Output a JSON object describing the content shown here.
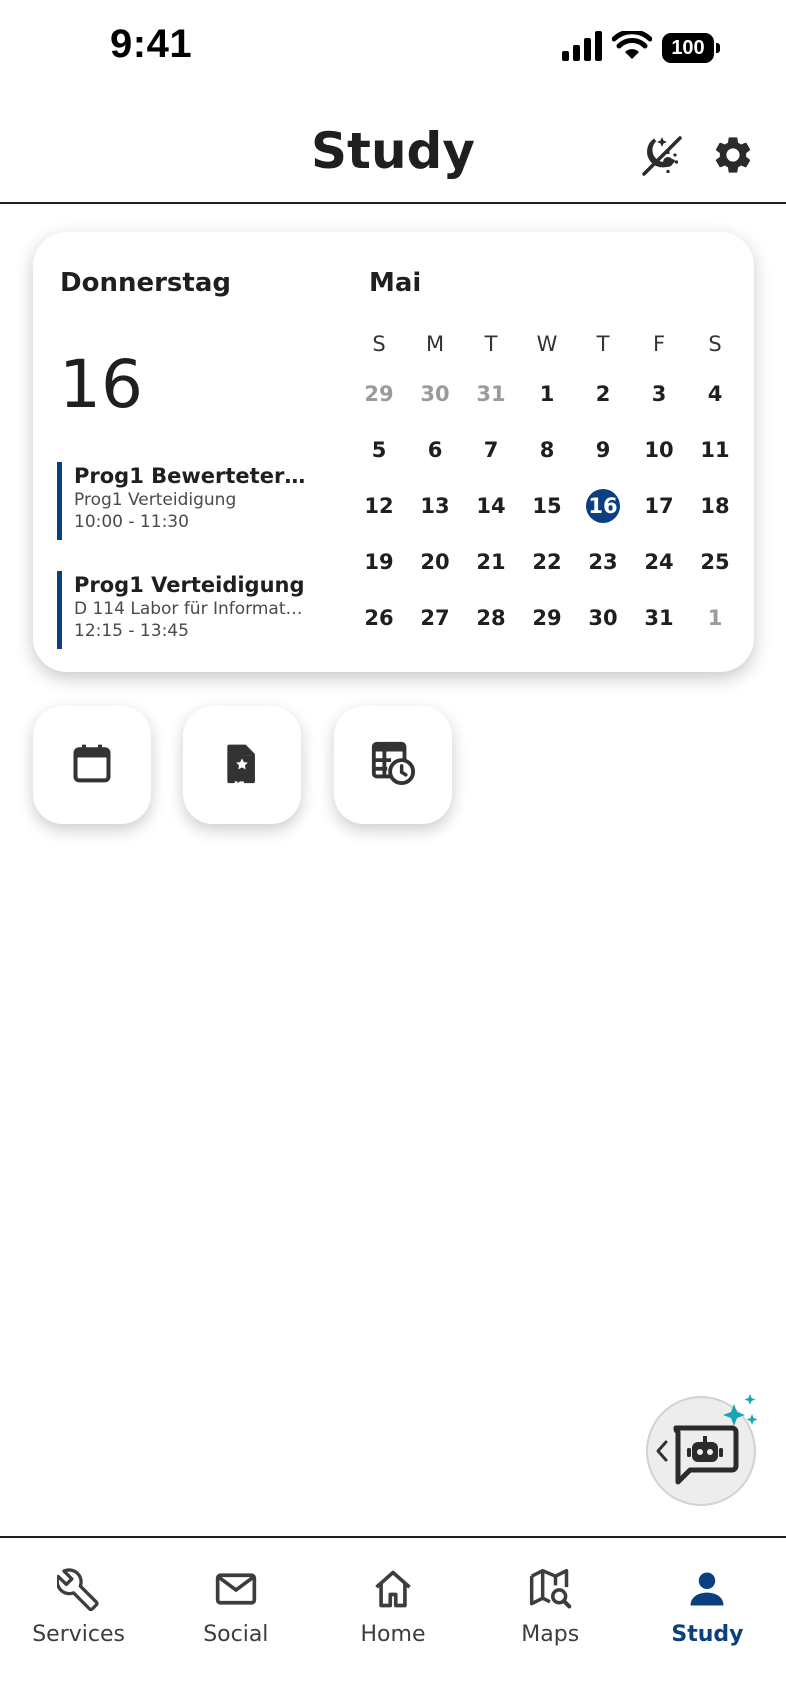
{
  "status_bar": {
    "time": "9:41",
    "battery": "100",
    "icons": [
      "cellular-signal-icon",
      "wifi-icon",
      "battery-icon"
    ]
  },
  "header": {
    "title": "Study",
    "icons": [
      "theme-toggle-icon",
      "gear-icon"
    ]
  },
  "calendar_card": {
    "weekday": "Donnerstag",
    "day_number": "16",
    "events": [
      {
        "title": "Prog1 Bewerteter …",
        "subtitle": "Prog1 Verteidigung",
        "time": "10:00 - 11:30"
      },
      {
        "title": "Prog1 Verteidigung",
        "subtitle": "D 114 Labor für Informat…",
        "time": "12:15 - 13:45"
      }
    ],
    "month": "Mai",
    "weekday_headers": [
      "S",
      "M",
      "T",
      "W",
      "T",
      "F",
      "S"
    ],
    "weeks": [
      [
        {
          "d": "29",
          "muted": true
        },
        {
          "d": "30",
          "muted": true
        },
        {
          "d": "31",
          "muted": true
        },
        {
          "d": "1"
        },
        {
          "d": "2"
        },
        {
          "d": "3"
        },
        {
          "d": "4"
        }
      ],
      [
        {
          "d": "5"
        },
        {
          "d": "6"
        },
        {
          "d": "7"
        },
        {
          "d": "8"
        },
        {
          "d": "9"
        },
        {
          "d": "10"
        },
        {
          "d": "11"
        }
      ],
      [
        {
          "d": "12"
        },
        {
          "d": "13"
        },
        {
          "d": "14"
        },
        {
          "d": "15"
        },
        {
          "d": "16",
          "today": true
        },
        {
          "d": "17"
        },
        {
          "d": "18"
        }
      ],
      [
        {
          "d": "19"
        },
        {
          "d": "20"
        },
        {
          "d": "21"
        },
        {
          "d": "22"
        },
        {
          "d": "23"
        },
        {
          "d": "24"
        },
        {
          "d": "25"
        }
      ],
      [
        {
          "d": "26"
        },
        {
          "d": "27"
        },
        {
          "d": "28"
        },
        {
          "d": "29"
        },
        {
          "d": "30"
        },
        {
          "d": "31"
        },
        {
          "d": "1",
          "muted": true
        }
      ]
    ]
  },
  "quick_actions": [
    "calendar-icon",
    "certificate-document-icon",
    "schedule-table-icon"
  ],
  "chatbot_fab": {
    "icon": "chatbot-robot-icon"
  },
  "bottom_nav": {
    "items": [
      {
        "label": "Services",
        "icon": "wrench-icon",
        "active": false
      },
      {
        "label": "Social",
        "icon": "mail-icon",
        "active": false
      },
      {
        "label": "Home",
        "icon": "home-icon",
        "active": false
      },
      {
        "label": "Maps",
        "icon": "map-search-icon",
        "active": false
      },
      {
        "label": "Study",
        "icon": "person-icon",
        "active": true
      }
    ]
  },
  "colors": {
    "accent": "#0b3f7f",
    "text": "#1f1f1f",
    "muted_text": "#9b9b9b",
    "sparkle": "#1aa3b5"
  }
}
